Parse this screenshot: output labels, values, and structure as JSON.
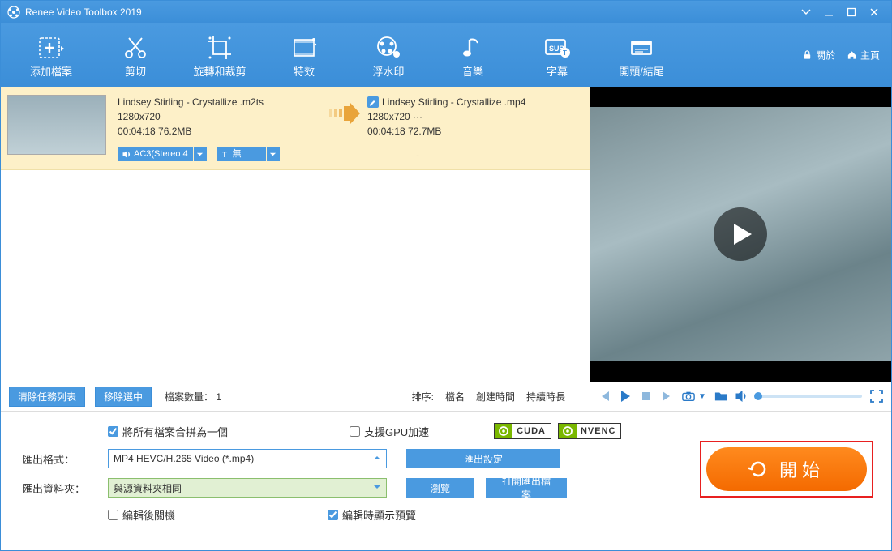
{
  "titlebar": {
    "title": "Renee Video Toolbox 2019"
  },
  "toolbar": {
    "items": [
      "添加檔案",
      "剪切",
      "旋轉和裁剪",
      "特效",
      "浮水印",
      "音樂",
      "字幕",
      "開頭/結尾"
    ],
    "about": "關於",
    "home": "主頁"
  },
  "file": {
    "src_name": "Lindsey Stirling - Crystallize .m2ts",
    "src_res": "1280x720",
    "src_dur_size": "00:04:18  76.2MB",
    "audio_tag": "AC3(Stereo 4",
    "subtitle_tag": "無",
    "out_name": "Lindsey Stirling - Crystallize .mp4",
    "out_res": "1280x720    ···",
    "out_dur_size": "00:04:18  72.7MB",
    "dash": "-"
  },
  "listbar": {
    "clear": "清除任務列表",
    "remove": "移除選中",
    "count_label": "檔案數量：",
    "count_value": "1",
    "sort_label": "排序:",
    "sort_name": "檔名",
    "sort_created": "創建時間",
    "sort_duration": "持續時長"
  },
  "settings": {
    "merge_all": "將所有檔案合拼為一個",
    "gpu_accel": "支援GPU加速",
    "cuda": "CUDA",
    "nvenc": "NVENC",
    "fmt_label": "匯出格式：",
    "fmt_value": "MP4 HEVC/H.265 Video (*.mp4)",
    "export_settings": "匯出設定",
    "folder_label": "匯出資料夾：",
    "folder_value": "與源資料夾相同",
    "browse": "瀏覽",
    "open_folder": "打開匯出檔案",
    "shutdown": "編輯後關機",
    "preview_on_edit": "編輯時顯示預覽",
    "start": "開始"
  }
}
